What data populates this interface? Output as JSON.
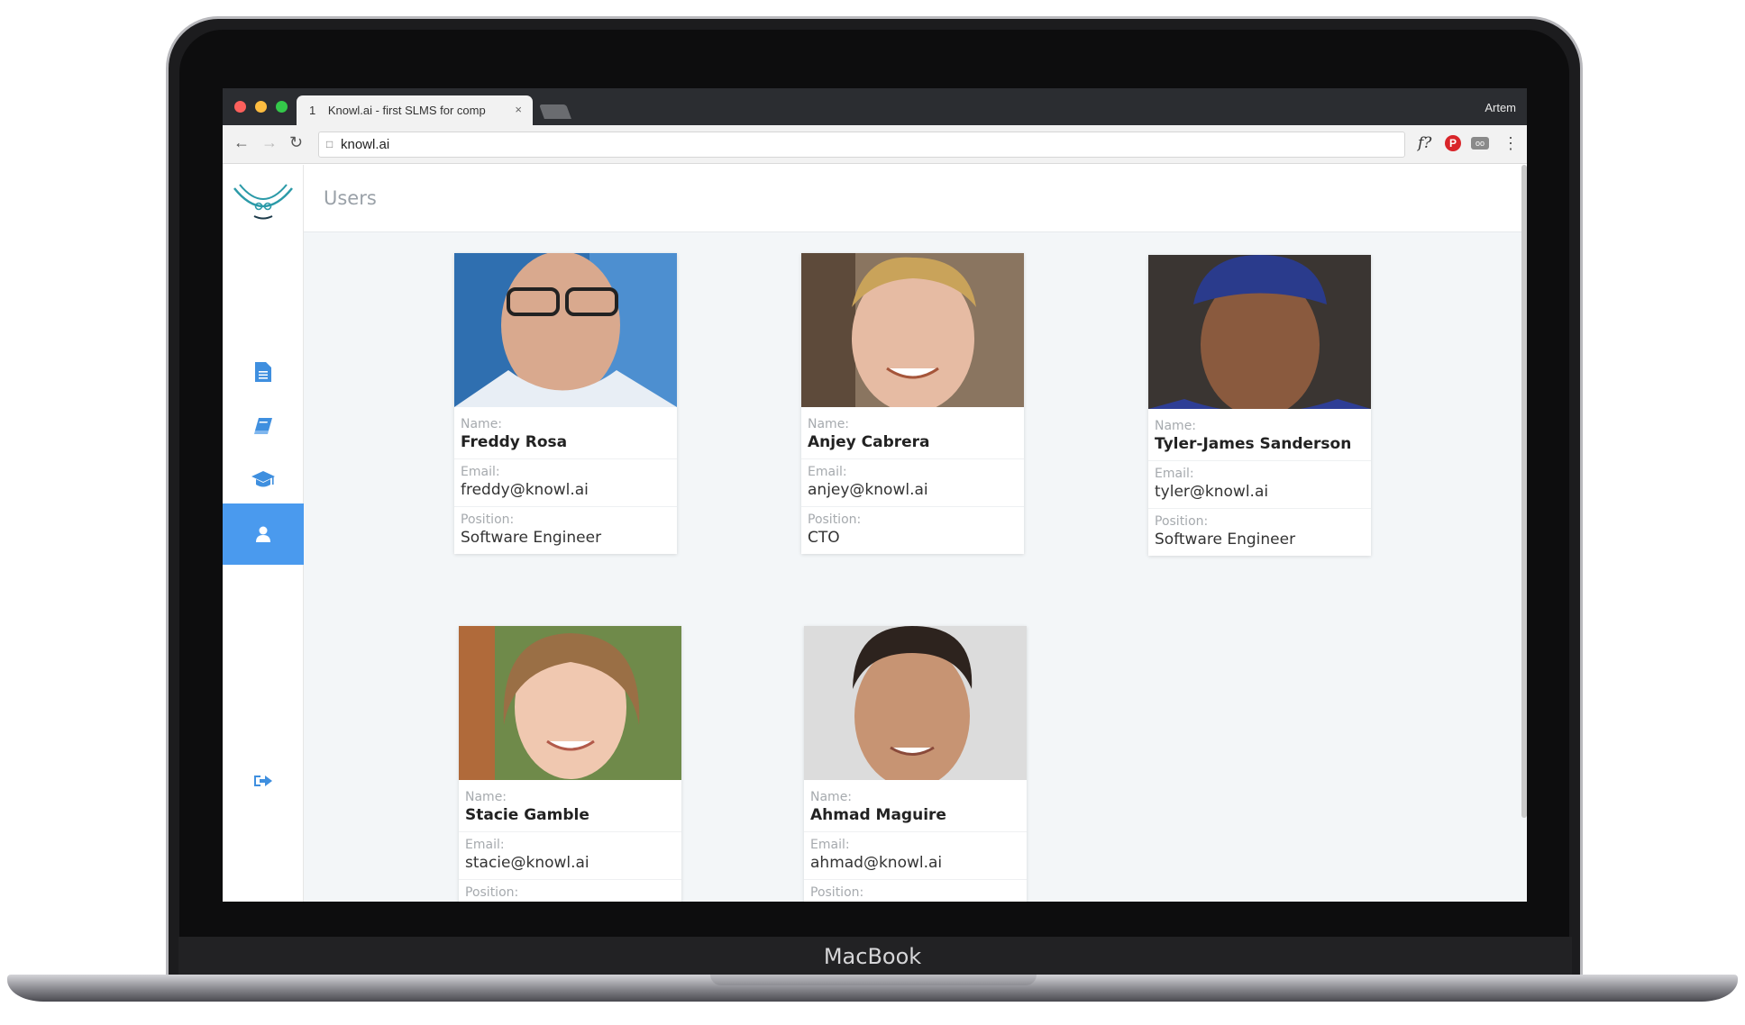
{
  "device": {
    "label": "MacBook"
  },
  "browser": {
    "tab": {
      "number": "1",
      "title": "Knowl.ai - first SLMS for comp",
      "close": "×"
    },
    "user": "Artem",
    "url": "knowl.ai",
    "extensions": {
      "f_label": "f?",
      "pin_label": "P",
      "glasses_label": "oo"
    }
  },
  "app": {
    "page_title": "Users",
    "sidebar": {
      "items": [
        {
          "name": "documents",
          "icon": "file-text-icon"
        },
        {
          "name": "book",
          "icon": "book-icon"
        },
        {
          "name": "courses",
          "icon": "graduation-cap-icon"
        },
        {
          "name": "users",
          "icon": "user-icon",
          "active": true
        },
        {
          "name": "logout",
          "icon": "sign-out-icon"
        }
      ]
    },
    "labels": {
      "name": "Name:",
      "email": "Email:",
      "position": "Position:"
    },
    "users": [
      {
        "name": "Freddy Rosa",
        "email": "freddy@knowl.ai",
        "position": "Software Engineer"
      },
      {
        "name": "Anjey Cabrera",
        "email": "anjey@knowl.ai",
        "position": "CTO"
      },
      {
        "name": "Tyler-James Sanderson",
        "email": "tyler@knowl.ai",
        "position": "Software Engineer"
      },
      {
        "name": "Stacie Gamble",
        "email": "stacie@knowl.ai",
        "position": ""
      },
      {
        "name": "Ahmad Maguire",
        "email": "ahmad@knowl.ai",
        "position": ""
      }
    ]
  }
}
